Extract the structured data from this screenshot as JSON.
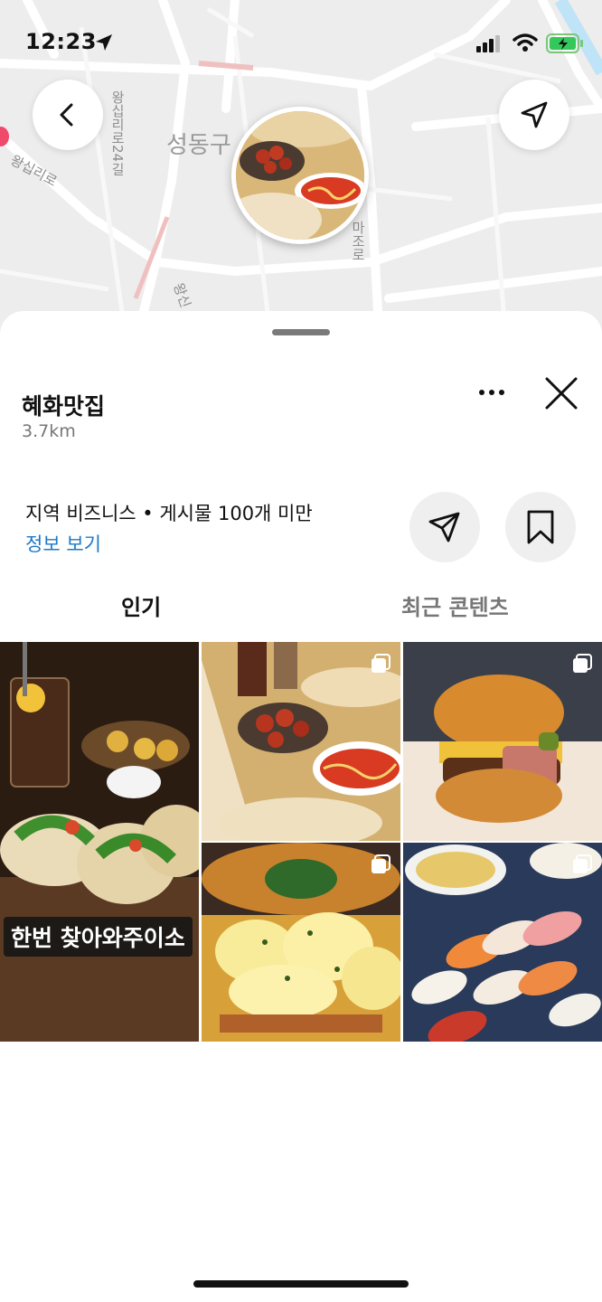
{
  "status_bar": {
    "time": "12:23"
  },
  "map": {
    "district_label": "성동구",
    "road_labels": [
      "왕십리로24길",
      "왕십리로",
      "마조로",
      "왕신"
    ]
  },
  "place": {
    "name": "혜화맛집",
    "distance": "3.7km",
    "meta": "지역 비즈니스 • 게시물 100개 미만",
    "info_link": "정보 보기"
  },
  "tabs": [
    {
      "label": "인기",
      "active": true
    },
    {
      "label": "최근 콘텐츠",
      "active": false
    }
  ],
  "grid": {
    "posts": [
      {
        "alt": "tacos",
        "overlay_text": "한번 찾아와주이소",
        "multi": false
      },
      {
        "alt": "curry and naan",
        "multi": true
      },
      {
        "alt": "burger",
        "multi": true
      },
      {
        "alt": "cheese fries",
        "multi": true
      },
      {
        "alt": "sushi",
        "multi": true
      }
    ]
  },
  "colors": {
    "accent_link": "#1b78c8",
    "sheet_bg": "#ffffff",
    "map_bg": "#ededed"
  },
  "icons": [
    "location-arrow-icon",
    "signal-icon",
    "wifi-icon",
    "battery-icon",
    "back-icon",
    "navigate-icon",
    "more-icon",
    "close-icon",
    "share-icon",
    "bookmark-icon",
    "multiple-posts-icon"
  ]
}
